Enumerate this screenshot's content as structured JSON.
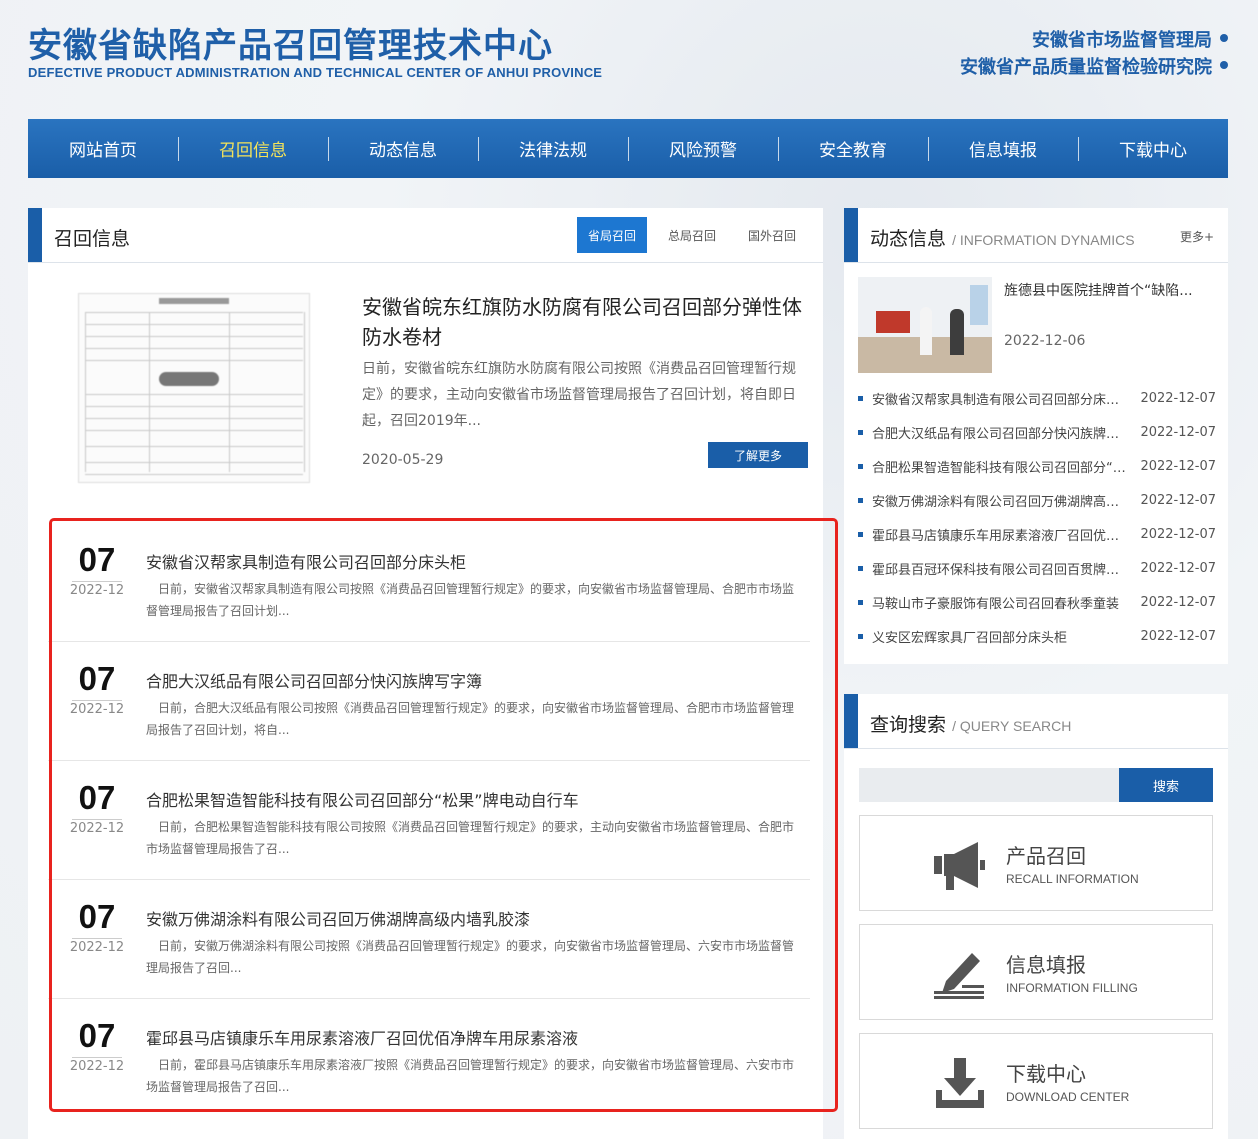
{
  "header": {
    "title": "安徽省缺陷产品召回管理技术中心",
    "subtitle": "DEFECTIVE PRODUCT ADMINISTRATION AND TECHNICAL CENTER OF ANHUI PROVINCE",
    "org1": "安徽省市场监督管理局",
    "org2": "安徽省产品质量监督检验研究院"
  },
  "nav": {
    "items": [
      "网站首页",
      "召回信息",
      "动态信息",
      "法律法规",
      "风险预警",
      "安全教育",
      "信息填报",
      "下载中心"
    ],
    "active": "召回信息"
  },
  "recall": {
    "title": "召回信息",
    "tabs": [
      "省局召回",
      "总局召回",
      "国外召回"
    ],
    "active_tab": "省局召回",
    "feature": {
      "title": "安徽省皖东红旗防水防腐有限公司召回部分弹性体防水卷材",
      "desc": "日前，安徽省皖东红旗防水防腐有限公司按照《消费品召回管理暂行规定》的要求，主动向安徽省市场监督管理局报告了召回计划，将自即日起，召回2019年...",
      "date": "2020-05-29",
      "more_label": "了解更多"
    },
    "items": [
      {
        "day": "07",
        "ym": "2022-12",
        "title": "安徽省汉帮家具制造有限公司召回部分床头柜",
        "desc": "日前，安徽省汉帮家具制造有限公司按照《消费品召回管理暂行规定》的要求，向安徽省市场监督管理局、合肥市市场监督管理局报告了召回计划..."
      },
      {
        "day": "07",
        "ym": "2022-12",
        "title": "合肥大汉纸品有限公司召回部分快闪族牌写字簿",
        "desc": "日前，合肥大汉纸品有限公司按照《消费品召回管理暂行规定》的要求，向安徽省市场监督管理局、合肥市市场监督管理局报告了召回计划，将自..."
      },
      {
        "day": "07",
        "ym": "2022-12",
        "title": "合肥松果智造智能科技有限公司召回部分“松果”牌电动自行车",
        "desc": "日前，合肥松果智造智能科技有限公司按照《消费品召回管理暂行规定》的要求，主动向安徽省市场监督管理局、合肥市市场监督管理局报告了召..."
      },
      {
        "day": "07",
        "ym": "2022-12",
        "title": "安徽万佛湖涂料有限公司召回万佛湖牌高级内墙乳胶漆",
        "desc": "日前，安徽万佛湖涂料有限公司按照《消费品召回管理暂行规定》的要求，向安徽省市场监督管理局、六安市市场监督管理局报告了召回..."
      },
      {
        "day": "07",
        "ym": "2022-12",
        "title": "霍邱县马店镇康乐车用尿素溶液厂召回优佰净牌车用尿素溶液",
        "desc": "日前，霍邱县马店镇康乐车用尿素溶液厂按照《消费品召回管理暂行规定》的要求，向安徽省市场监督管理局、六安市市场监督管理局报告了召回..."
      }
    ]
  },
  "dynamics": {
    "title": "动态信息",
    "title_en": "/ INFORMATION DYNAMICS",
    "more": "更多+",
    "top": {
      "title": "旌德县中医院挂牌首个“缺陷...",
      "date": "2022-12-06"
    },
    "items": [
      {
        "title": "安徽省汉帮家具制造有限公司召回部分床头柜",
        "date": "2022-12-07"
      },
      {
        "title": "合肥大汉纸品有限公司召回部分快闪族牌写字簿",
        "date": "2022-12-07"
      },
      {
        "title": "合肥松果智造智能科技有限公司召回部分“松果”牌电动自行车",
        "date": "2022-12-07"
      },
      {
        "title": "安徽万佛湖涂料有限公司召回万佛湖牌高级内墙乳胶漆",
        "date": "2022-12-07"
      },
      {
        "title": "霍邱县马店镇康乐车用尿素溶液厂召回优佰净牌车用尿素溶液",
        "date": "2022-12-07"
      },
      {
        "title": "霍邱县百冠环保科技有限公司召回百贯牌车用尿素溶液",
        "date": "2022-12-07"
      },
      {
        "title": "马鞍山市子豪服饰有限公司召回春秋季童装",
        "date": "2022-12-07"
      },
      {
        "title": "义安区宏辉家具厂召回部分床头柜",
        "date": "2022-12-07"
      }
    ]
  },
  "search": {
    "title": "查询搜索",
    "title_en": "/ QUERY SEARCH",
    "button": "搜索",
    "input_value": "",
    "boxes": [
      {
        "cn": "产品召回",
        "en": "RECALL INFORMATION",
        "icon": "megaphone-icon"
      },
      {
        "cn": "信息填报",
        "en": "INFORMATION FILLING",
        "icon": "pen-icon"
      },
      {
        "cn": "下载中心",
        "en": "DOWNLOAD CENTER",
        "icon": "download-icon"
      }
    ]
  }
}
